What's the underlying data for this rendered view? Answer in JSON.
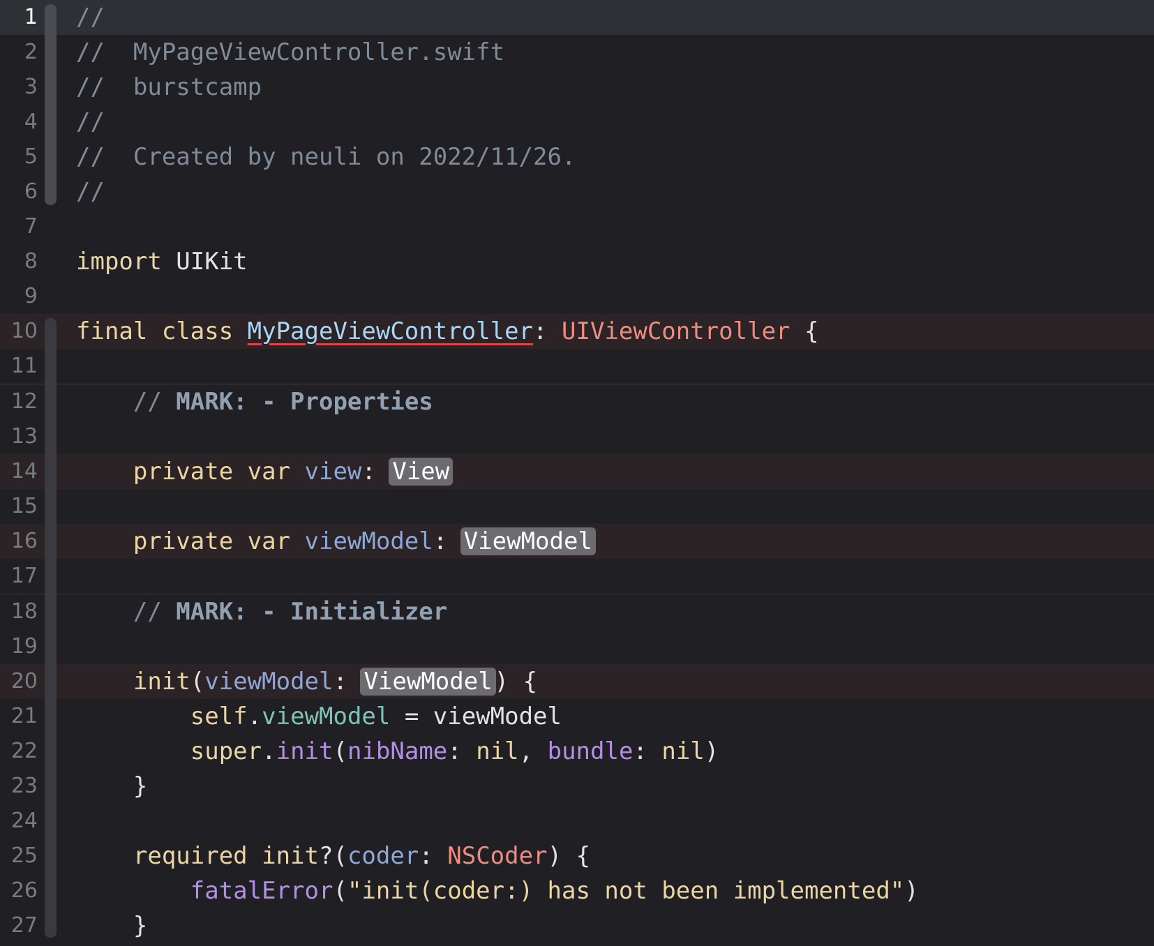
{
  "editor": {
    "file_name": "MyPageViewController.swift",
    "current_line": 1,
    "lines": [
      {
        "n": "1",
        "state": "current",
        "tokens": [
          {
            "t": "//",
            "k": "comment"
          }
        ]
      },
      {
        "n": "2",
        "tokens": [
          {
            "t": "//  MyPageViewController.swift",
            "k": "comment"
          }
        ]
      },
      {
        "n": "3",
        "tokens": [
          {
            "t": "//  burstcamp",
            "k": "comment"
          }
        ]
      },
      {
        "n": "4",
        "tokens": [
          {
            "t": "//",
            "k": "comment"
          }
        ]
      },
      {
        "n": "5",
        "tokens": [
          {
            "t": "//  Created by neuli on 2022/11/26.",
            "k": "comment"
          }
        ]
      },
      {
        "n": "6",
        "tokens": [
          {
            "t": "//",
            "k": "comment"
          }
        ]
      },
      {
        "n": "7",
        "tokens": []
      },
      {
        "n": "8",
        "tokens": [
          {
            "t": "import",
            "k": "keyword"
          },
          {
            "t": " UIKit",
            "k": "plain"
          }
        ]
      },
      {
        "n": "9",
        "tokens": []
      },
      {
        "n": "10",
        "state": "hl",
        "tokens": [
          {
            "t": "final class ",
            "k": "keyword"
          },
          {
            "t": "MyPageViewController",
            "k": "decl",
            "squiggle": true
          },
          {
            "t": ": ",
            "k": "punct"
          },
          {
            "t": "UIViewController",
            "k": "type"
          },
          {
            "t": " {",
            "k": "punct"
          }
        ]
      },
      {
        "n": "11",
        "tokens": []
      },
      {
        "n": "12",
        "mark": true,
        "tokens": [
          {
            "t": "    // ",
            "k": "comment"
          },
          {
            "t": "MARK: - Properties",
            "k": "mark"
          }
        ]
      },
      {
        "n": "13",
        "tokens": []
      },
      {
        "n": "14",
        "state": "hl",
        "tokens": [
          {
            "t": "    private var ",
            "k": "keyword"
          },
          {
            "t": "view",
            "k": "prop"
          },
          {
            "t": ": ",
            "k": "punct"
          },
          {
            "t": "View",
            "k": "placeholder"
          }
        ]
      },
      {
        "n": "15",
        "tokens": []
      },
      {
        "n": "16",
        "state": "hl",
        "tokens": [
          {
            "t": "    private var ",
            "k": "keyword"
          },
          {
            "t": "viewModel",
            "k": "prop"
          },
          {
            "t": ": ",
            "k": "punct"
          },
          {
            "t": "ViewModel",
            "k": "placeholder"
          }
        ]
      },
      {
        "n": "17",
        "tokens": []
      },
      {
        "n": "18",
        "mark": true,
        "tokens": [
          {
            "t": "    // ",
            "k": "comment"
          },
          {
            "t": "MARK: - Initializer",
            "k": "mark"
          }
        ]
      },
      {
        "n": "19",
        "tokens": []
      },
      {
        "n": "20",
        "state": "hl",
        "tokens": [
          {
            "t": "    init",
            "k": "keyword"
          },
          {
            "t": "(",
            "k": "punct"
          },
          {
            "t": "viewModel",
            "k": "prop"
          },
          {
            "t": ": ",
            "k": "punct"
          },
          {
            "t": "ViewModel",
            "k": "placeholder"
          },
          {
            "t": ") {",
            "k": "punct"
          }
        ]
      },
      {
        "n": "21",
        "tokens": [
          {
            "t": "        self",
            "k": "keyword"
          },
          {
            "t": ".",
            "k": "punct"
          },
          {
            "t": "viewModel",
            "k": "member"
          },
          {
            "t": " = viewModel",
            "k": "plain"
          }
        ]
      },
      {
        "n": "22",
        "tokens": [
          {
            "t": "        super",
            "k": "keyword"
          },
          {
            "t": ".",
            "k": "punct"
          },
          {
            "t": "init",
            "k": "call"
          },
          {
            "t": "(",
            "k": "punct"
          },
          {
            "t": "nibName",
            "k": "label"
          },
          {
            "t": ": ",
            "k": "punct"
          },
          {
            "t": "nil",
            "k": "keyword"
          },
          {
            "t": ", ",
            "k": "punct"
          },
          {
            "t": "bundle",
            "k": "label"
          },
          {
            "t": ": ",
            "k": "punct"
          },
          {
            "t": "nil",
            "k": "keyword"
          },
          {
            "t": ")",
            "k": "punct"
          }
        ]
      },
      {
        "n": "23",
        "tokens": [
          {
            "t": "    }",
            "k": "punct"
          }
        ]
      },
      {
        "n": "24",
        "tokens": []
      },
      {
        "n": "25",
        "tokens": [
          {
            "t": "    required init",
            "k": "keyword"
          },
          {
            "t": "?(",
            "k": "punct"
          },
          {
            "t": "coder",
            "k": "prop"
          },
          {
            "t": ": ",
            "k": "punct"
          },
          {
            "t": "NSCoder",
            "k": "type"
          },
          {
            "t": ") {",
            "k": "punct"
          }
        ]
      },
      {
        "n": "26",
        "tokens": [
          {
            "t": "        fatalError",
            "k": "call"
          },
          {
            "t": "(",
            "k": "punct"
          },
          {
            "t": "\"init(coder:) has not been implemented\"",
            "k": "string"
          },
          {
            "t": ")",
            "k": "punct"
          }
        ]
      },
      {
        "n": "27",
        "tokens": [
          {
            "t": "    }",
            "k": "punct"
          }
        ]
      }
    ]
  }
}
